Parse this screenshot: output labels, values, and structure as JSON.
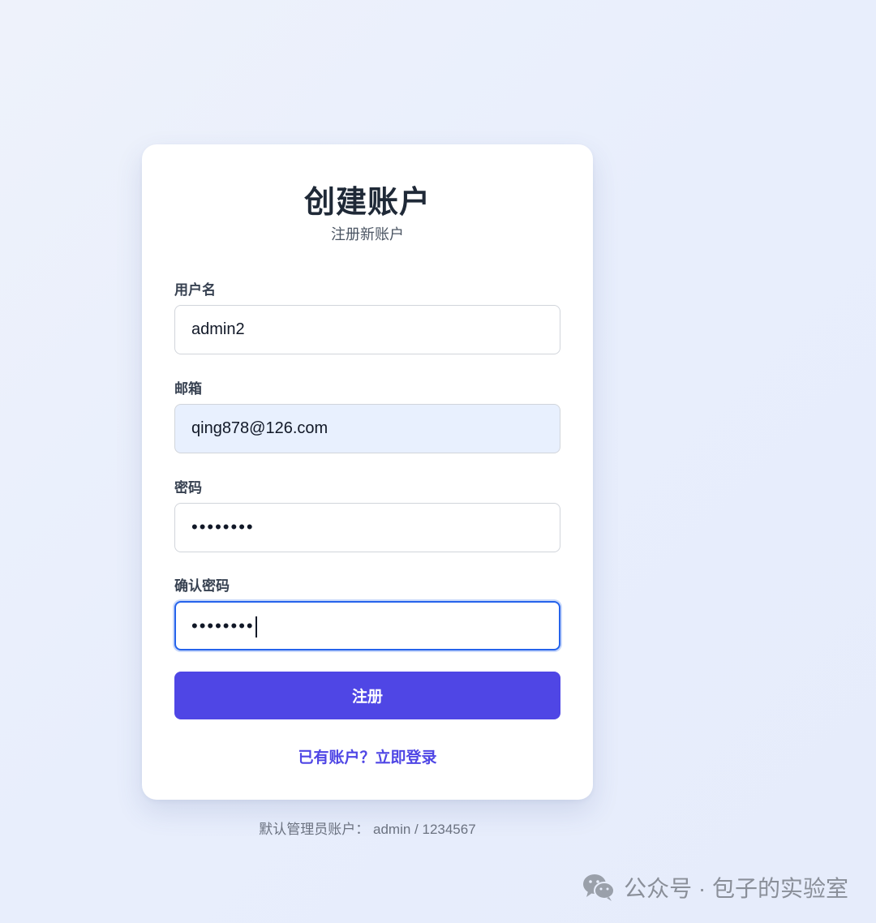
{
  "form": {
    "title": "创建账户",
    "subtitle": "注册新账户",
    "username": {
      "label": "用户名",
      "value": "admin2"
    },
    "email": {
      "label": "邮箱",
      "value": "qing878@126.com"
    },
    "password": {
      "label": "密码",
      "value": "••••••••"
    },
    "confirm_password": {
      "label": "确认密码",
      "value": "••••••••"
    },
    "submit_label": "注册",
    "login_link": "已有账户？立即登录"
  },
  "hint": "默认管理员账户： admin / 1234567",
  "watermark": {
    "text": "公众号 · 包子的实验室",
    "icon": "wechat-icon"
  },
  "colors": {
    "primary": "#4f46e5",
    "focus": "#2563eb",
    "autofill": "#e8f0fe",
    "background": "#e8eefc"
  }
}
